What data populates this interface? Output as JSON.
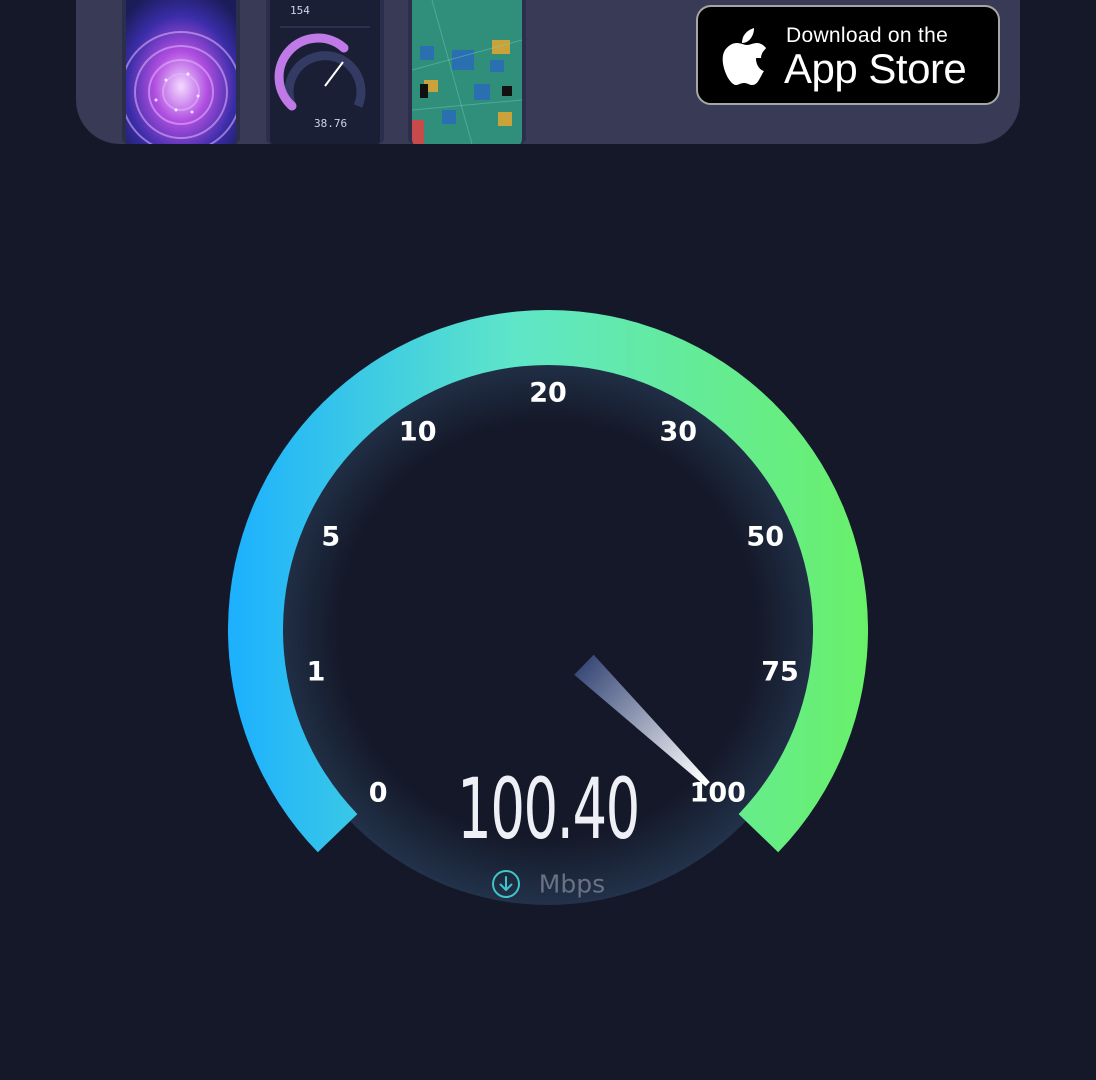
{
  "banner": {
    "phone2": {
      "top_value": "154",
      "gauge_value": "38.76"
    },
    "appstore": {
      "line1": "Download on the",
      "line2": "App Store",
      "icon": "apple-icon"
    }
  },
  "gauge": {
    "scale_labels": [
      "0",
      "1",
      "5",
      "10",
      "20",
      "30",
      "50",
      "75",
      "100"
    ],
    "reading": "100.40",
    "unit": "Mbps",
    "direction_icon": "download-arrow-icon",
    "needle_level": 1.0,
    "colors": {
      "arc_start": "#1cb0ff",
      "arc_mid": "#5fe6c8",
      "arc_end": "#69f06a",
      "background": "#141828",
      "banner": "#383a56"
    }
  }
}
